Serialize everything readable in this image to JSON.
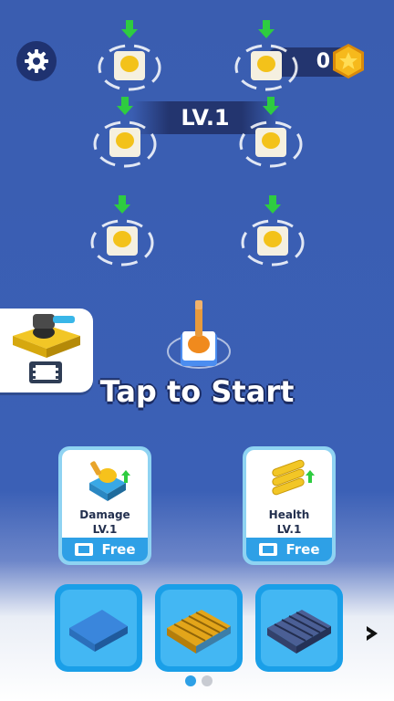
{
  "hud": {
    "coins": "0",
    "level": "LV.1"
  },
  "game": {
    "prompt": "Tap to Start"
  },
  "upgrades": [
    {
      "name": "Damage",
      "level": "LV.1",
      "cta": "Free"
    },
    {
      "name": "Health",
      "level": "LV.1",
      "cta": "Free"
    }
  ],
  "icons": {
    "settings": "gear-icon",
    "coin": "coin-icon",
    "video": "video-ad-icon",
    "next": "chevron-right-icon"
  },
  "colors": {
    "background": "#3a5db0",
    "accent": "#1a9fe8",
    "arrow_green": "#2ecc40",
    "coin_gold": "#f6b91c"
  },
  "pagination": {
    "current": 1,
    "total": 2
  }
}
